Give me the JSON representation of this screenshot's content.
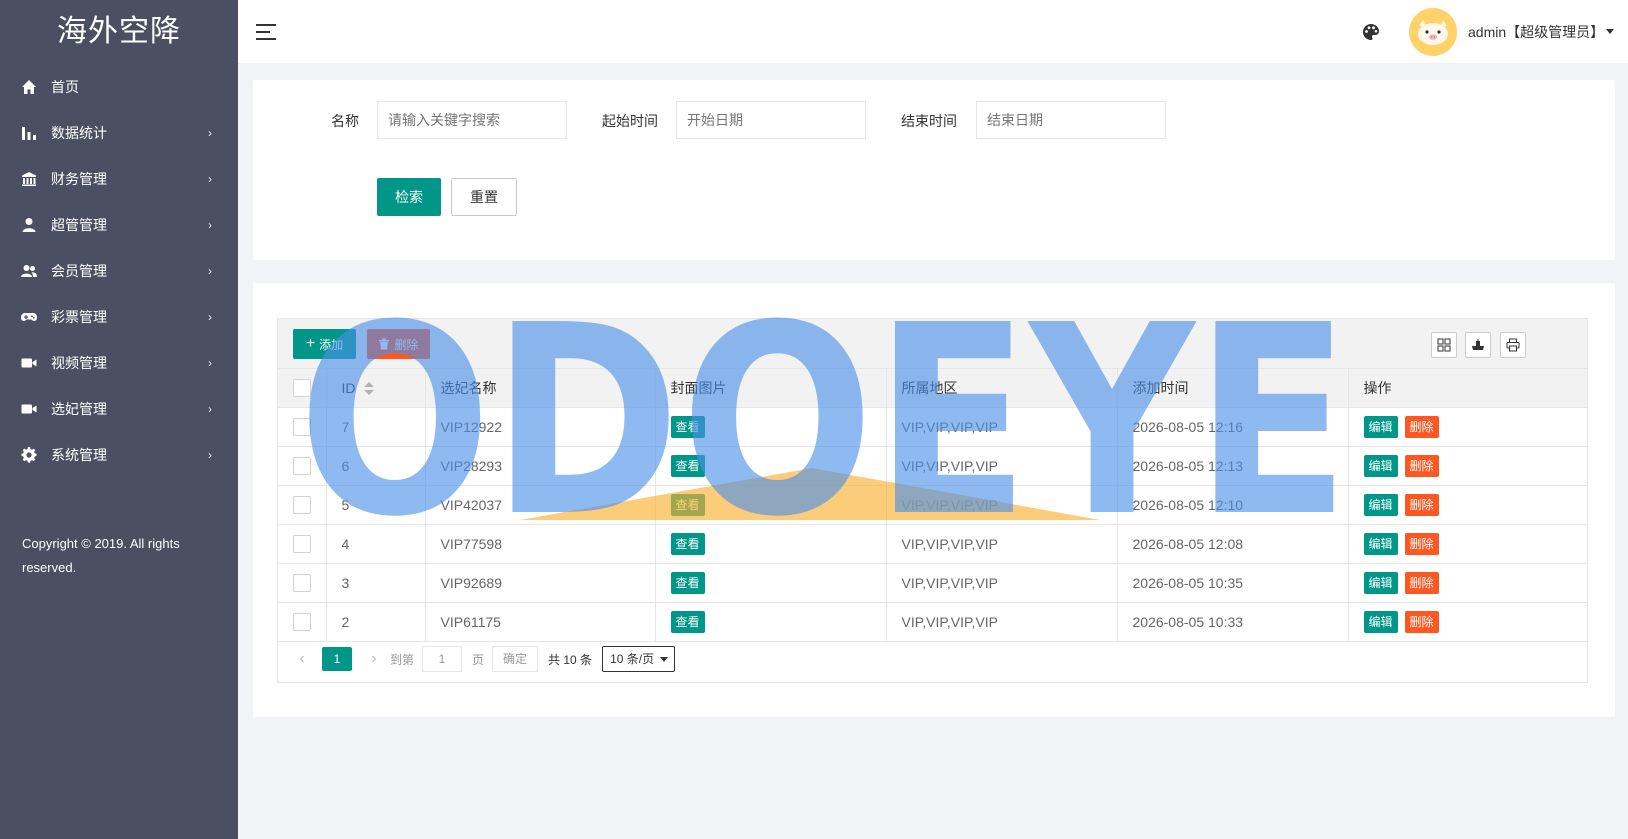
{
  "brand": {
    "title": "海外空降"
  },
  "sidebar": {
    "items": [
      {
        "label": "首页",
        "icon": "home-icon",
        "has_children": false
      },
      {
        "label": "数据统计",
        "icon": "bar-chart-icon",
        "has_children": true
      },
      {
        "label": "财务管理",
        "icon": "bank-icon",
        "has_children": true
      },
      {
        "label": "超管管理",
        "icon": "user-icon",
        "has_children": true
      },
      {
        "label": "会员管理",
        "icon": "users-icon",
        "has_children": true
      },
      {
        "label": "彩票管理",
        "icon": "gamepad-icon",
        "has_children": true
      },
      {
        "label": "视频管理",
        "icon": "video-icon",
        "has_children": true
      },
      {
        "label": "选妃管理",
        "icon": "video-icon",
        "has_children": true
      },
      {
        "label": "系统管理",
        "icon": "gear-icon",
        "has_children": true
      }
    ],
    "chevron": "›",
    "copyright": "Copyright © 2019. All rights reserved."
  },
  "header": {
    "user_label": "admin【超级管理员】"
  },
  "search": {
    "name_label": "名称",
    "name_placeholder": "请输入关键字搜索",
    "start_label": "起始时间",
    "start_placeholder": "开始日期",
    "end_label": "结束时间",
    "end_placeholder": "结束日期",
    "search_button": "检索",
    "reset_button": "重置"
  },
  "toolbar": {
    "add_label": "添加",
    "delete_label": "删除"
  },
  "table": {
    "columns": [
      "ID",
      "选妃名称",
      "封面图片",
      "所属地区",
      "添加时间",
      "操作"
    ],
    "view_label": "查看",
    "edit_label": "编辑",
    "remove_label": "删除",
    "rows": [
      {
        "id": "7",
        "name": "VIP12922",
        "region": "VIP,VIP,VIP,VIP",
        "time": "2026-08-05 12:16"
      },
      {
        "id": "6",
        "name": "VIP28293",
        "region": "VIP,VIP,VIP,VIP",
        "time": "2026-08-05 12:13"
      },
      {
        "id": "5",
        "name": "VIP42037",
        "region": "VIP,VIP,VIP,VIP",
        "time": "2026-08-05 12:10"
      },
      {
        "id": "4",
        "name": "VIP77598",
        "region": "VIP,VIP,VIP,VIP",
        "time": "2026-08-05 12:08"
      },
      {
        "id": "3",
        "name": "VIP92689",
        "region": "VIP,VIP,VIP,VIP",
        "time": "2026-08-05 10:35"
      },
      {
        "id": "2",
        "name": "VIP61175",
        "region": "VIP,VIP,VIP,VIP",
        "time": "2026-08-05 10:33"
      }
    ]
  },
  "pagination": {
    "current_page": "1",
    "goto_label": "到第",
    "goto_value": "1",
    "page_suffix": "页",
    "confirm_label": "确定",
    "total_label": "共 10 条",
    "page_size": "10 条/页"
  },
  "watermark": {
    "text": "ODOEYE"
  },
  "colors": {
    "sidebar_bg": "#4a5061",
    "primary": "#009688",
    "danger": "#ff5722",
    "watermark_blue": "#4a8fe8",
    "watermark_orange": "#f9b233"
  }
}
